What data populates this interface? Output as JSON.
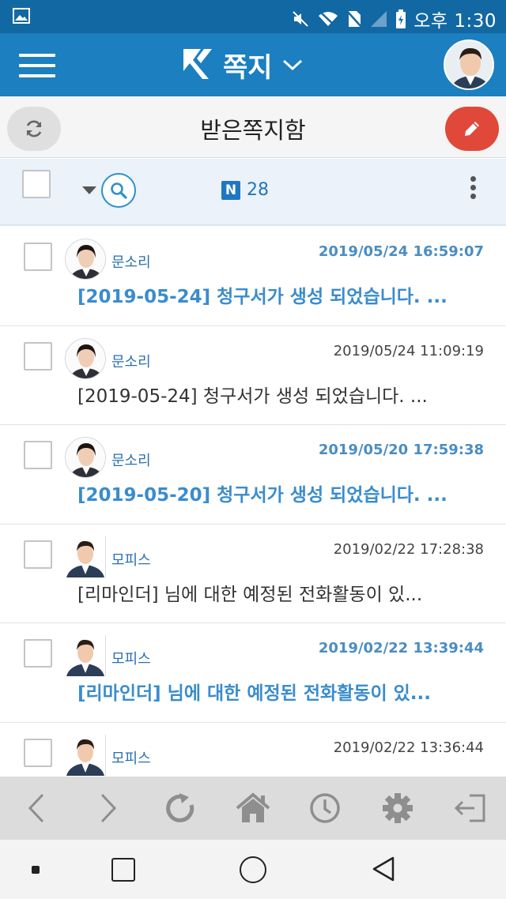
{
  "status_bar": {
    "time": "오후 1:30",
    "icons": [
      "gallery-icon",
      "mute-icon",
      "wifi-icon",
      "no-sim-icon",
      "signal-icon",
      "battery-icon"
    ]
  },
  "app_bar": {
    "title": "쪽지",
    "icons": [
      "menu-icon",
      "app-logo-icon",
      "chevron-down-icon",
      "avatar"
    ]
  },
  "sub_header": {
    "title": "받은쪽지함",
    "colors": {
      "compose": "#e0483a",
      "refresh": "#dfdfdf"
    }
  },
  "toolbar": {
    "badge": "N",
    "count": "28"
  },
  "messages": [
    {
      "sender": "문소리",
      "date": "2019/05/24 16:59:07",
      "subject": "[2019-05-24] 청구서가 생성 되었습니다. ...",
      "unread": true
    },
    {
      "sender": "문소리",
      "date": "2019/05/24 11:09:19",
      "subject": "[2019-05-24] 청구서가 생성 되었습니다. ...",
      "unread": false
    },
    {
      "sender": "문소리",
      "date": "2019/05/20 17:59:38",
      "subject": "[2019-05-20] 청구서가 생성 되었습니다. ...",
      "unread": true
    },
    {
      "sender": "모피스",
      "date": "2019/02/22 17:28:38",
      "subject": "[리마인더] 님에 대한 예정된 전화활동이 있...",
      "unread": false
    },
    {
      "sender": "모피스",
      "date": "2019/02/22 13:39:44",
      "subject": "[리마인더] 님에 대한 예정된 전화활동이 있...",
      "unread": true
    },
    {
      "sender": "모피스",
      "date": "2019/02/22 13:36:44",
      "subject": "",
      "unread": false
    }
  ],
  "bottom_nav": [
    "back-arrow-icon",
    "forward-arrow-icon",
    "reload-icon",
    "home-icon",
    "clock-icon",
    "gear-icon",
    "logout-icon"
  ],
  "colors": {
    "app_bar": "#1b7fc0",
    "status_bar": "#1268a3",
    "unread_text": "#3a8ccd"
  }
}
